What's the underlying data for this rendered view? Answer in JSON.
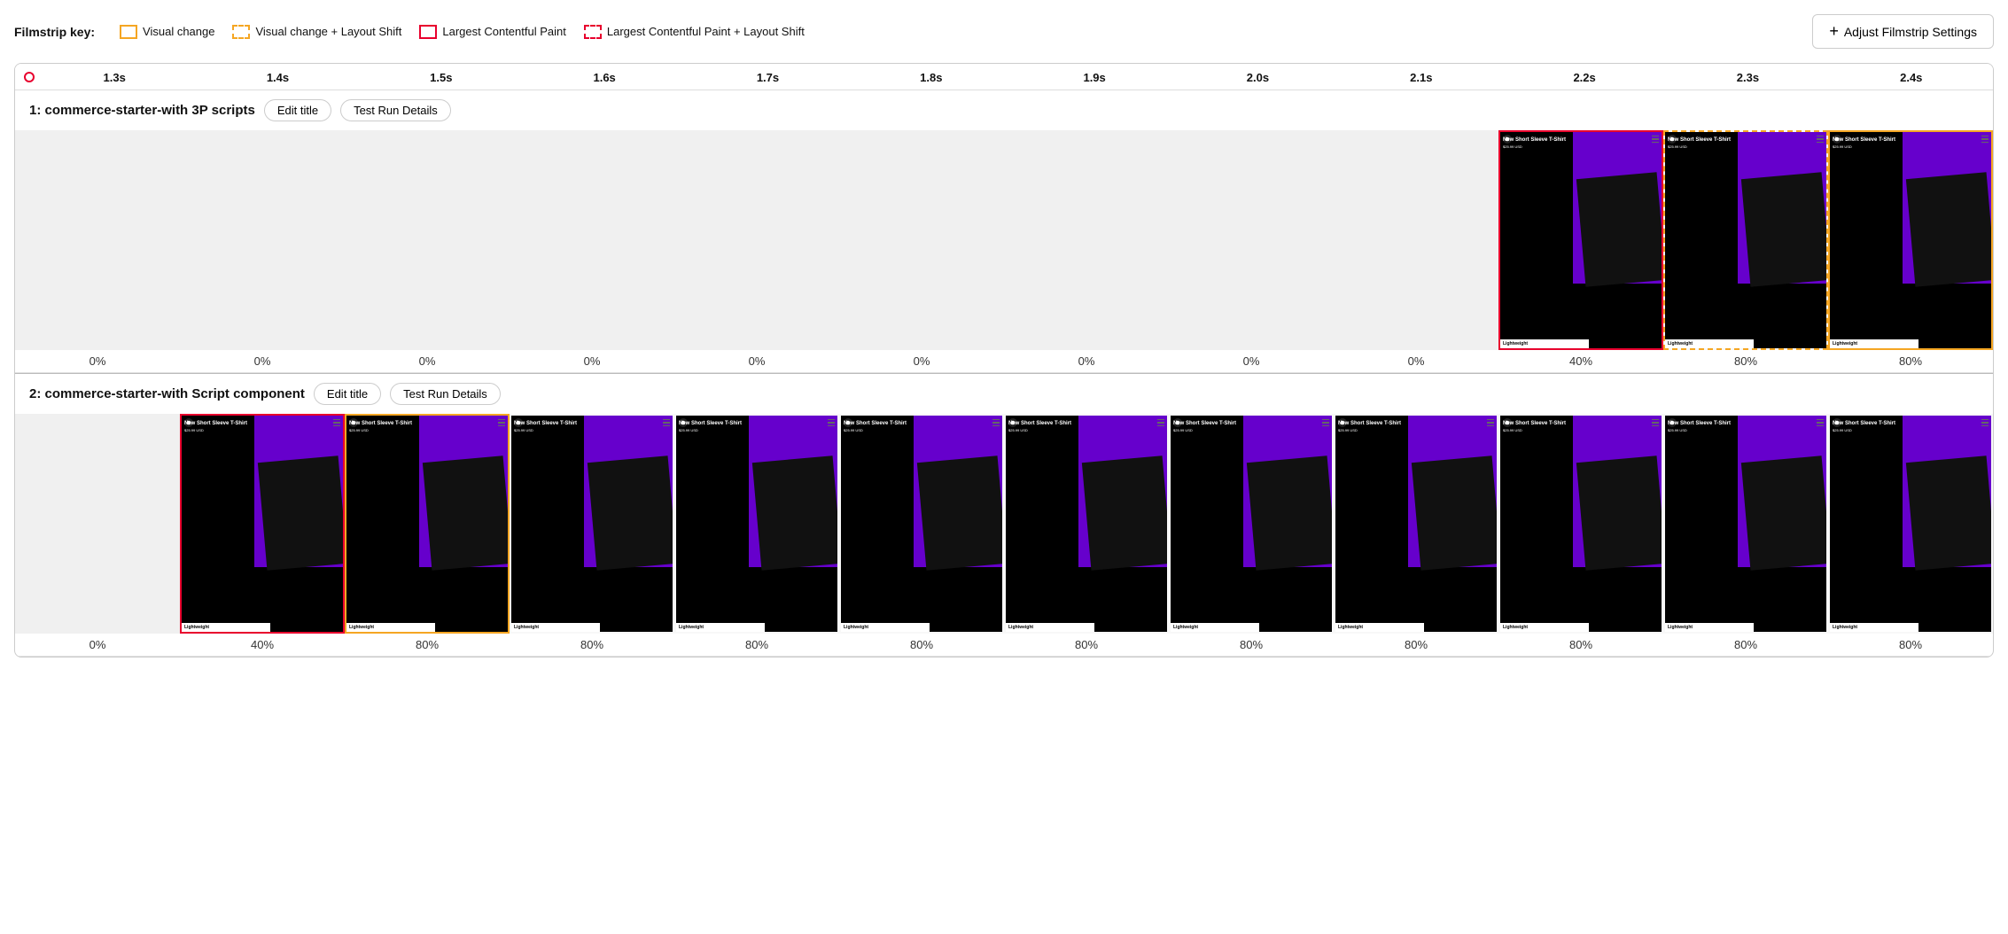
{
  "legend": {
    "key_label": "Filmstrip key:",
    "items": [
      {
        "id": "visual-change",
        "label": "Visual change",
        "border_style": "solid",
        "color": "#f5a623"
      },
      {
        "id": "visual-change-layout-shift",
        "label": "Visual change + Layout Shift",
        "border_style": "dashed",
        "color": "#f5a623"
      },
      {
        "id": "lcp",
        "label": "Largest Contentful Paint",
        "border_style": "solid",
        "color": "#e8002d"
      },
      {
        "id": "lcp-layout-shift",
        "label": "Largest Contentful Paint + Layout Shift",
        "border_style": "dashed",
        "color": "#e8002d"
      }
    ],
    "adjust_button_label": "Adjust Filmstrip Settings"
  },
  "timeline": {
    "marks": [
      "1.3s",
      "1.4s",
      "1.5s",
      "1.6s",
      "1.7s",
      "1.8s",
      "1.9s",
      "2.0s",
      "2.1s",
      "2.2s",
      "2.3s",
      "2.4s"
    ]
  },
  "tests": [
    {
      "id": "test-1",
      "number": "1",
      "title": "commerce-starter-with 3P scripts",
      "edit_title_label": "Edit title",
      "test_run_details_label": "Test Run Details",
      "frames": [
        {
          "id": "f1-1",
          "border": "none",
          "empty": true,
          "has_content": false,
          "percent": "0%"
        },
        {
          "id": "f1-2",
          "border": "none",
          "empty": true,
          "has_content": false,
          "percent": "0%"
        },
        {
          "id": "f1-3",
          "border": "none",
          "empty": true,
          "has_content": false,
          "percent": "0%"
        },
        {
          "id": "f1-4",
          "border": "none",
          "empty": true,
          "has_content": false,
          "percent": "0%"
        },
        {
          "id": "f1-5",
          "border": "none",
          "empty": true,
          "has_content": false,
          "percent": "0%"
        },
        {
          "id": "f1-6",
          "border": "none",
          "empty": true,
          "has_content": false,
          "percent": "0%"
        },
        {
          "id": "f1-7",
          "border": "none",
          "empty": true,
          "has_content": false,
          "percent": "0%"
        },
        {
          "id": "f1-8",
          "border": "none",
          "empty": true,
          "has_content": false,
          "percent": "0%"
        },
        {
          "id": "f1-9",
          "border": "none",
          "empty": true,
          "has_content": false,
          "percent": "0%"
        },
        {
          "id": "f1-10",
          "border": "red",
          "empty": false,
          "has_content": true,
          "percent": "40%",
          "title": "New Short Sleeve T-Shirt",
          "price": "$25.99 USD",
          "badge": "Lightweight"
        },
        {
          "id": "f1-11",
          "border": "yellow-dashed",
          "empty": false,
          "has_content": true,
          "percent": "80%",
          "title": "New Short Sleeve T-Shirt",
          "price": "$25.99 USD",
          "badge": "Lightweight"
        },
        {
          "id": "f1-12",
          "border": "yellow",
          "empty": false,
          "has_content": true,
          "percent": "80%",
          "title": "New Short Sleeve T-Shirt",
          "price": "$25.99 USD",
          "badge": "Lightweight"
        }
      ]
    },
    {
      "id": "test-2",
      "number": "2",
      "title": "commerce-starter-with Script component",
      "edit_title_label": "Edit title",
      "test_run_details_label": "Test Run Details",
      "frames": [
        {
          "id": "f2-1",
          "border": "none",
          "empty": true,
          "has_content": false,
          "percent": "0%"
        },
        {
          "id": "f2-2",
          "border": "red",
          "empty": false,
          "has_content": true,
          "percent": "40%",
          "title": "New Short Sleeve T-Shirt",
          "price": "$25.99 USD",
          "badge": "Lightweight"
        },
        {
          "id": "f2-3",
          "border": "yellow",
          "empty": false,
          "has_content": true,
          "percent": "80%",
          "title": "New Short Sleeve T-Shirt",
          "price": "$25.99 USD",
          "badge": "Lightweight"
        },
        {
          "id": "f2-4",
          "border": "none",
          "empty": false,
          "has_content": true,
          "percent": "80%",
          "title": "New Short Sleeve T-Shirt",
          "price": "$25.99 USD",
          "badge": "Lightweight"
        },
        {
          "id": "f2-5",
          "border": "none",
          "empty": false,
          "has_content": true,
          "percent": "80%",
          "title": "New Short Sleeve T-Shirt",
          "price": "$25.99 USD",
          "badge": "Lightweight"
        },
        {
          "id": "f2-6",
          "border": "none",
          "empty": false,
          "has_content": true,
          "percent": "80%",
          "title": "New Short Sleeve T-Shirt",
          "price": "$25.99 USD",
          "badge": "Lightweight"
        },
        {
          "id": "f2-7",
          "border": "none",
          "empty": false,
          "has_content": true,
          "percent": "80%",
          "title": "New Short Sleeve T-Shirt",
          "price": "$25.99 USD",
          "badge": "Lightweight"
        },
        {
          "id": "f2-8",
          "border": "none",
          "empty": false,
          "has_content": true,
          "percent": "80%",
          "title": "New Short Sleeve T-Shirt",
          "price": "$25.99 USD",
          "badge": "Lightweight"
        },
        {
          "id": "f2-9",
          "border": "none",
          "empty": false,
          "has_content": true,
          "percent": "80%",
          "title": "New Short Sleeve T-Shirt",
          "price": "$25.99 USD",
          "badge": "Lightweight"
        },
        {
          "id": "f2-10",
          "border": "none",
          "empty": false,
          "has_content": true,
          "percent": "80%",
          "title": "New Short Sleeve T-Shirt",
          "price": "$25.99 USD",
          "badge": "Lightweight"
        },
        {
          "id": "f2-11",
          "border": "none",
          "empty": false,
          "has_content": true,
          "percent": "80%",
          "title": "New Short Sleeve T-Shirt",
          "price": "$25.99 USD",
          "badge": "Lightweight"
        },
        {
          "id": "f2-12",
          "border": "none",
          "empty": false,
          "has_content": true,
          "percent": "80%",
          "title": "New Short Sleeve T-Shirt",
          "price": "$25.99 USD",
          "badge": "Lightweight"
        }
      ]
    }
  ]
}
